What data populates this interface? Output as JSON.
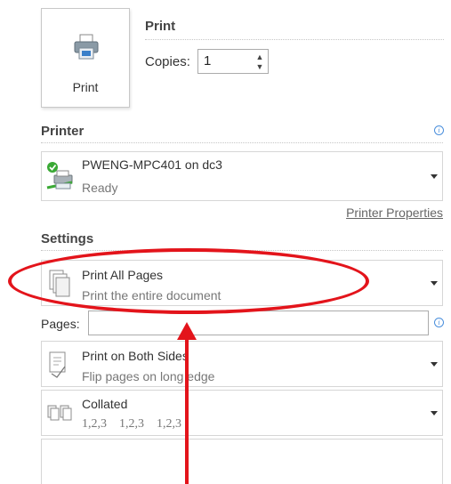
{
  "print_button": {
    "label": "Print",
    "icon": "printer-icon"
  },
  "print_section": {
    "title": "Print",
    "copies_label": "Copies:",
    "copies_value": "1"
  },
  "printer_section": {
    "title": "Printer",
    "info_icon": "info-icon",
    "printer_name": "PWENG-MPC401 on dc3",
    "status": "Ready",
    "properties_link": "Printer Properties"
  },
  "settings_section": {
    "title": "Settings",
    "items": [
      {
        "main": "Print All Pages",
        "sub": "Print the entire document",
        "icon": "pages-icon"
      },
      {
        "main": "Print on Both Sides",
        "sub": "Flip pages on long edge",
        "icon": "duplex-icon"
      },
      {
        "main": "Collated",
        "sub": "1,2,3    1,2,3    1,2,3",
        "icon": "collated-icon"
      }
    ],
    "pages_label": "Pages:",
    "pages_value": ""
  },
  "annotation": {
    "color": "#e3141b"
  }
}
